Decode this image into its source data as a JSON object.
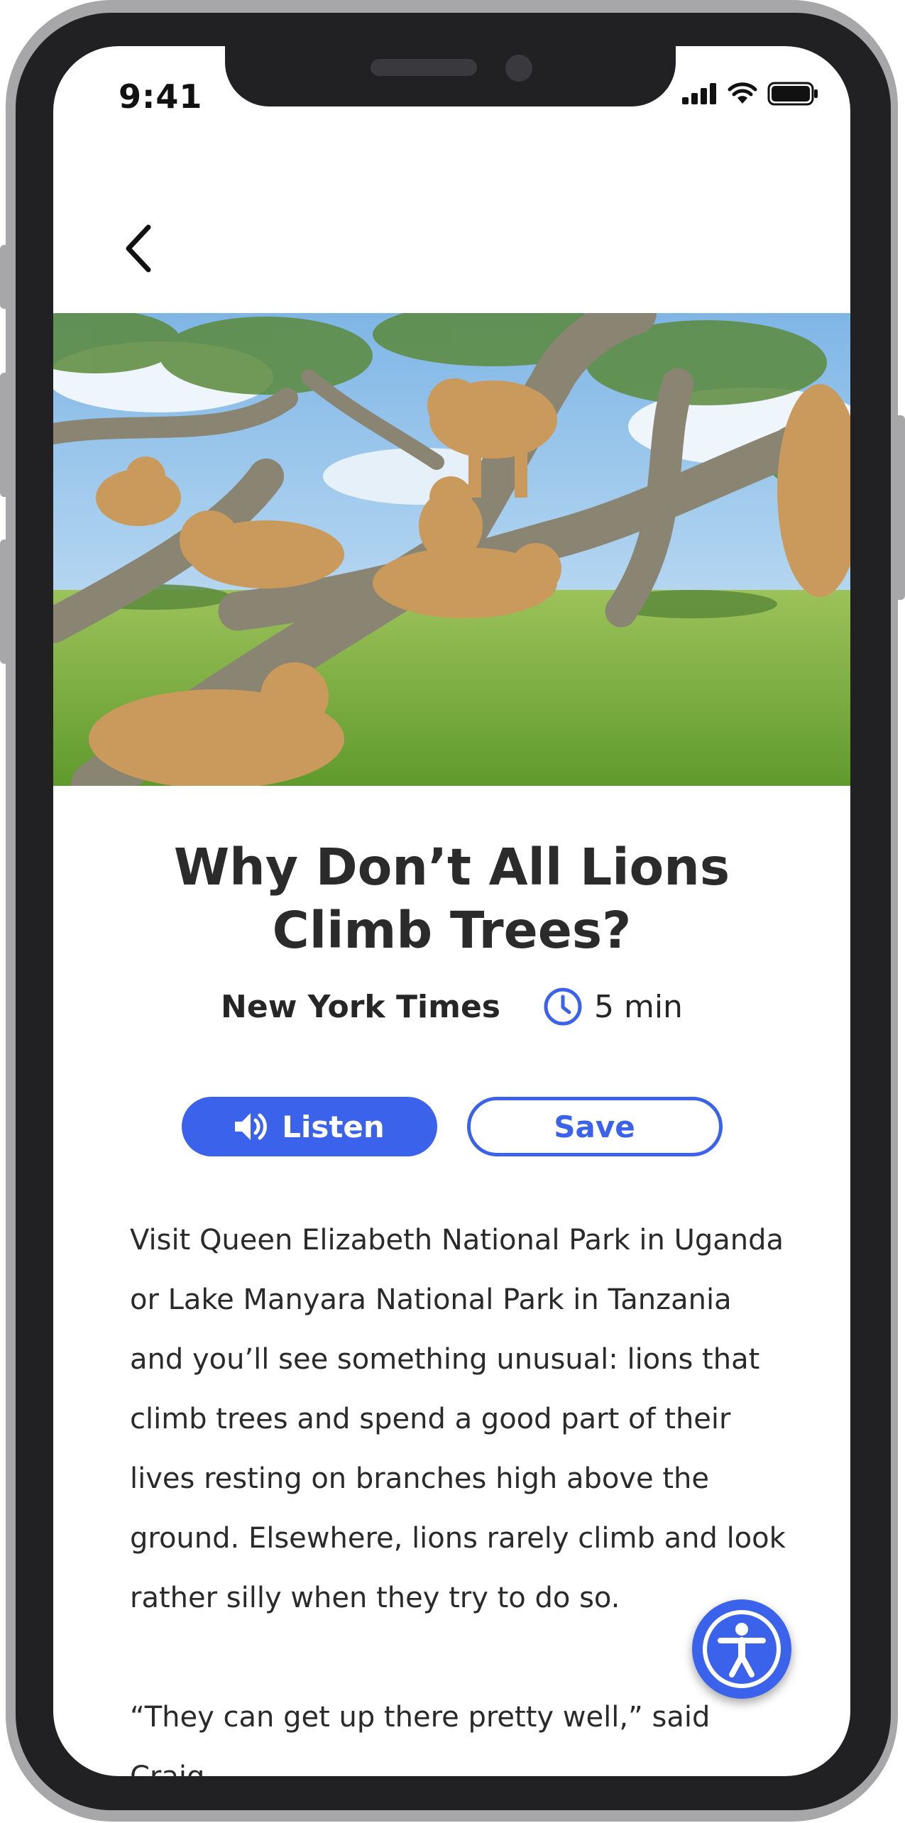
{
  "status_bar": {
    "time": "9:41"
  },
  "navigation": {
    "back_icon": "chevron-left-icon"
  },
  "hero_image": {
    "description": "lions-in-tree"
  },
  "article": {
    "title": "Why Don’t All Lions\nClimb Trees?",
    "source": "New York Times",
    "read_time": "5 min",
    "paragraphs": [
      "Visit Queen Elizabeth National Park in Uganda or Lake Manyara National Park in Tanzania and you’ll see something unusual: lions that climb trees and spend a good part of their lives resting on branches high above the ground. Elsewhere, lions rarely climb and look rather silly when they try to do so.",
      "“They can get up there pretty well,” said Craig"
    ]
  },
  "actions": {
    "listen_label": "Listen",
    "save_label": "Save"
  },
  "colors": {
    "accent": "#3b62ea",
    "text": "#2a2a2a",
    "frame": "#212124"
  }
}
